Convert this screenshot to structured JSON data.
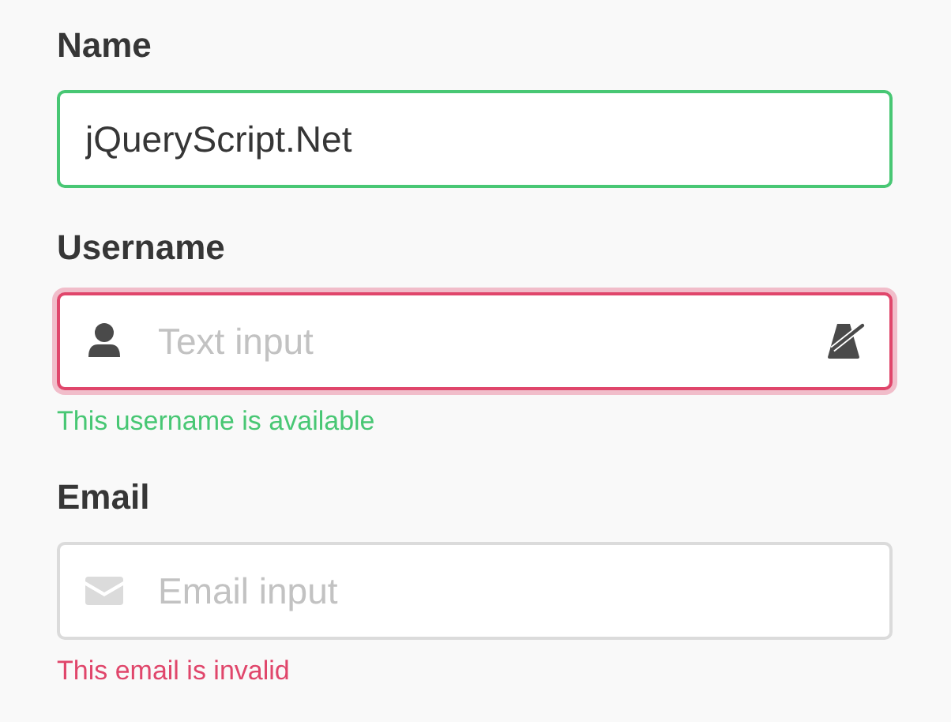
{
  "fields": [
    {
      "label": "Name",
      "kind": "plain",
      "value": "jQueryScript.Net",
      "color": "#48c774"
    },
    {
      "label": "Username",
      "kind": "user",
      "placeholder": "Text input",
      "color": "#e0466b",
      "help": {
        "text": "This username is available",
        "color": "#48c774"
      }
    },
    {
      "label": "Email",
      "kind": "email",
      "placeholder": "Email input",
      "color": "#dbdbdb",
      "help": {
        "text": "This email is invalid",
        "color": "#e0466b"
      }
    }
  ]
}
